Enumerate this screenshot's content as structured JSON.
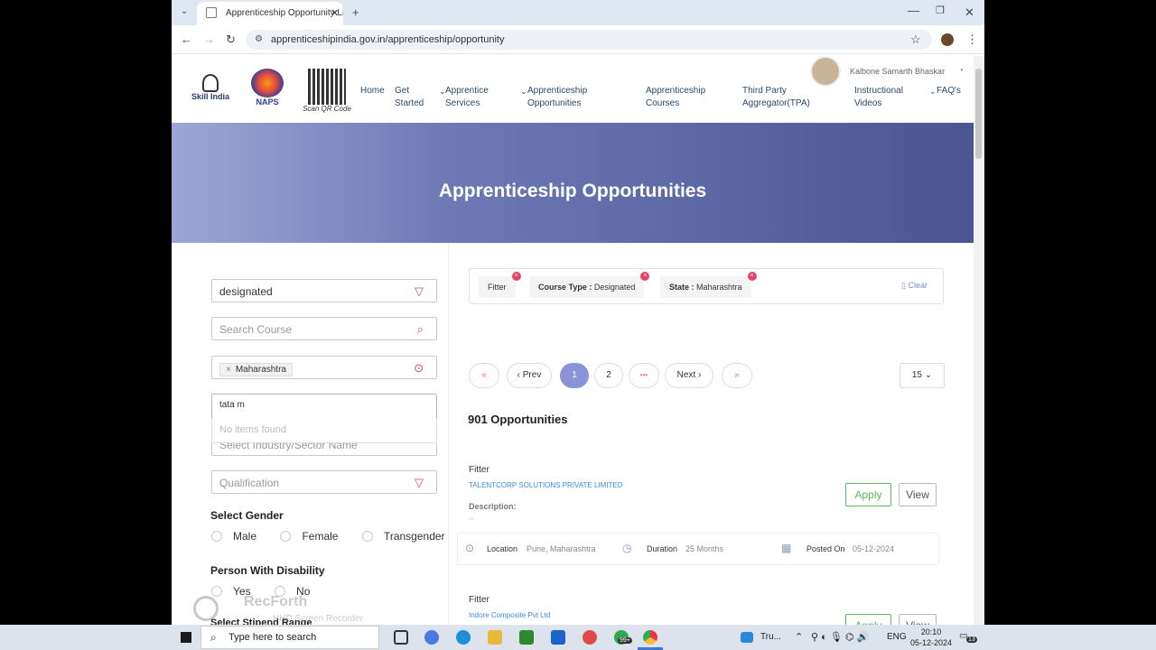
{
  "browser": {
    "tab_title": "Apprenticeship Opportunity Li",
    "url": "apprenticeshipindia.gov.in/apprenticeship/opportunity"
  },
  "header": {
    "skill_india": "Skill India",
    "naps": "NAPS",
    "qr_caption": "Scan QR Code",
    "user_name": "Kalbone Samarth Bhaskar",
    "nav": [
      {
        "label": "Home"
      },
      {
        "label": "Get Started"
      },
      {
        "label": "Apprentice Services"
      },
      {
        "label": "Apprenticeship Opportunities"
      },
      {
        "label": "Apprenticeship Courses"
      },
      {
        "label": "Third Party Aggregator(TPA)"
      },
      {
        "label": "Instructional Videos"
      },
      {
        "label": "FAQ's"
      }
    ]
  },
  "hero": {
    "title": "Apprenticeship Opportunities"
  },
  "filters": {
    "course_type_value": "designated",
    "search_course_placeholder": "Search Course",
    "state_tag": "Maharashtra",
    "company_input_value": "tata m",
    "no_items": "No items found",
    "industry_placeholder": "Select Industry/Sector Name",
    "qualification_placeholder": "Qualification",
    "gender_label": "Select Gender",
    "gender_options": [
      "Male",
      "Female",
      "Transgender"
    ],
    "disability_label": "Person With Disability",
    "disability_options": [
      "Yes",
      "No"
    ],
    "stipend_label": "Select Stipend Range"
  },
  "chips": {
    "c1": "Fitter",
    "c2_key": "Course Type :",
    "c2_val": "Designated",
    "c3_key": "State :",
    "c3_val": "Maharashtra",
    "clear": "Clear"
  },
  "pagination": {
    "prev": "Prev",
    "page1": "1",
    "page2": "2",
    "ellipsis": "•••",
    "next": "Next",
    "per_page": "15"
  },
  "results": {
    "count": "901 Opportunities",
    "listings": [
      {
        "title": "Fitter",
        "company": "TALENTCORP SOLUTIONS PRIVATE LIMITED",
        "desc_label": "Description:",
        "desc_value": "--",
        "apply": "Apply",
        "view": "View",
        "location_label": "Location",
        "location_value": "Pune, Maharashtra",
        "duration_label": "Duration",
        "duration_value": "25 Months",
        "posted_label": "Posted On",
        "posted_value": "05-12-2024"
      },
      {
        "title": "Fitter",
        "company": "Indore Composite Pvt Ltd",
        "apply": "Apply",
        "view": "View"
      }
    ]
  },
  "watermark": {
    "brand": "RecForth",
    "sub": "HHD Screen Recorder"
  },
  "taskbar": {
    "search_placeholder": "Type here to search",
    "tru": "Tru...",
    "lang": "ENG",
    "time": "20:10",
    "date": "05-12-2024",
    "badge": "99+",
    "notif": "13"
  }
}
